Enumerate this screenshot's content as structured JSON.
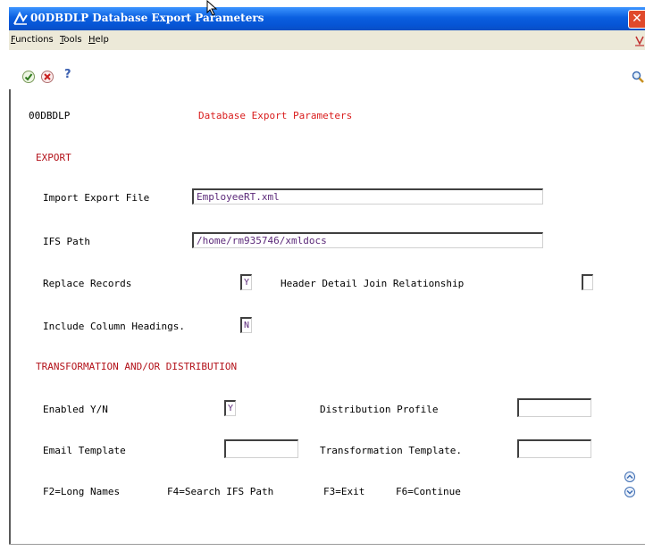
{
  "window": {
    "title": "00DBDLP  Database Export Parameters",
    "close_glyph": "✕"
  },
  "menubar": {
    "items": [
      {
        "label": "Functions",
        "mnemonic": "F",
        "rest": "unctions"
      },
      {
        "label": "Tools",
        "mnemonic": "T",
        "rest": "ools"
      },
      {
        "label": "Help",
        "mnemonic": "H",
        "rest": "elp"
      }
    ]
  },
  "toolbar": {
    "ok_icon": "checkmark-icon",
    "cancel_icon": "cancel-icon",
    "help_label": "?",
    "search_icon": "magnifier-icon"
  },
  "form": {
    "program_id": "00DBDLP",
    "screen_title": "Database Export Parameters",
    "export_section": "EXPORT",
    "import_export_file": {
      "label": "Import Export File",
      "value": "EmployeeRT.xml"
    },
    "ifs_path": {
      "label": "IFS Path",
      "value": "/home/rm935746/xmldocs"
    },
    "replace_records": {
      "label": "Replace Records",
      "value": "Y"
    },
    "header_detail_join": {
      "label": "Header Detail Join Relationship",
      "value": ""
    },
    "include_column_headings": {
      "label": "Include Column Headings.",
      "value": "N"
    },
    "transformation_section": "TRANSFORMATION AND/OR DISTRIBUTION",
    "enabled": {
      "label": "Enabled Y/N",
      "value": "Y"
    },
    "distribution_profile": {
      "label": "Distribution Profile",
      "value": ""
    },
    "email_template": {
      "label": "Email Template",
      "value": ""
    },
    "transformation_template": {
      "label": "Transformation Template.",
      "value": ""
    }
  },
  "function_keys": {
    "f2": "F2=Long Names",
    "f4": "F4=Search IFS Path",
    "f3": "F3=Exit",
    "f6": "F6=Continue"
  },
  "colors": {
    "titlebar": "#0a5fe0",
    "label_red": "#d91c1c",
    "field_text": "#5c2a7a"
  }
}
